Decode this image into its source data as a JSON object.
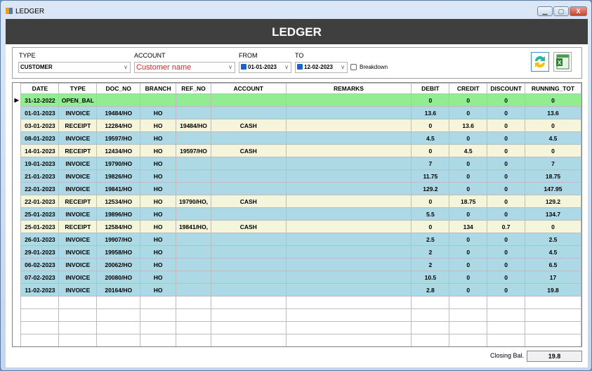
{
  "window": {
    "title": "LEDGER",
    "minimize": "▁",
    "maximize": "▢",
    "close": "X"
  },
  "header": {
    "title": "LEDGER"
  },
  "filters": {
    "type_label": "TYPE",
    "type_value": "CUSTOMER",
    "account_label": "ACCOUNT",
    "account_value": "Customer name",
    "account_color": "#e8202a",
    "from_label": "FROM",
    "from_value": "01-01-2023",
    "from_checked": true,
    "to_label": "TO",
    "to_value": "12-02-2023",
    "to_checked": true,
    "breakdown_label": "Breakdown",
    "breakdown_checked": false,
    "refresh_icon": "refresh-icon",
    "excel_icon": "excel-icon"
  },
  "grid": {
    "columns": [
      "DATE",
      "TYPE",
      "DOC_NO",
      "BRANCH",
      "REF_NO",
      "ACCOUNT",
      "REMARKS",
      "DEBIT",
      "CREDIT",
      "DISCOUNT",
      "RUNNING_TOT"
    ],
    "row_colors": {
      "OPEN_BAL": "#90ee90",
      "INVOICE": "#add8e6",
      "RECEIPT": "#f5f5dc"
    },
    "rows": [
      [
        "31-12-2022",
        "OPEN_BAL",
        "",
        "",
        "",
        "",
        "",
        "0",
        "0",
        "0",
        "0"
      ],
      [
        "01-01-2023",
        "INVOICE",
        "19484/HO",
        "HO",
        "",
        "",
        "",
        "13.6",
        "0",
        "0",
        "13.6"
      ],
      [
        "03-01-2023",
        "RECEIPT",
        "12284/HO",
        "HO",
        "19484/HO",
        "CASH",
        "",
        "0",
        "13.6",
        "0",
        "0"
      ],
      [
        "08-01-2023",
        "INVOICE",
        "19597/HO",
        "HO",
        "",
        "",
        "",
        "4.5",
        "0",
        "0",
        "4.5"
      ],
      [
        "14-01-2023",
        "RECEIPT",
        "12434/HO",
        "HO",
        "19597/HO",
        "CASH",
        "",
        "0",
        "4.5",
        "0",
        "0"
      ],
      [
        "19-01-2023",
        "INVOICE",
        "19790/HO",
        "HO",
        "",
        "",
        "",
        "7",
        "0",
        "0",
        "7"
      ],
      [
        "21-01-2023",
        "INVOICE",
        "19826/HO",
        "HO",
        "",
        "",
        "",
        "11.75",
        "0",
        "0",
        "18.75"
      ],
      [
        "22-01-2023",
        "INVOICE",
        "19841/HO",
        "HO",
        "",
        "",
        "",
        "129.2",
        "0",
        "0",
        "147.95"
      ],
      [
        "22-01-2023",
        "RECEIPT",
        "12534/HO",
        "HO",
        "19790/HO,",
        "CASH",
        "",
        "0",
        "18.75",
        "0",
        "129.2"
      ],
      [
        "25-01-2023",
        "INVOICE",
        "19896/HO",
        "HO",
        "",
        "",
        "",
        "5.5",
        "0",
        "0",
        "134.7"
      ],
      [
        "25-01-2023",
        "RECEIPT",
        "12584/HO",
        "HO",
        "19841/HO,",
        "CASH",
        "",
        "0",
        "134",
        "0.7",
        "0"
      ],
      [
        "26-01-2023",
        "INVOICE",
        "19907/HO",
        "HO",
        "",
        "",
        "",
        "2.5",
        "0",
        "0",
        "2.5"
      ],
      [
        "29-01-2023",
        "INVOICE",
        "19958/HO",
        "HO",
        "",
        "",
        "",
        "2",
        "0",
        "0",
        "4.5"
      ],
      [
        "06-02-2023",
        "INVOICE",
        "20062/HO",
        "HO",
        "",
        "",
        "",
        "2",
        "0",
        "0",
        "6.5"
      ],
      [
        "07-02-2023",
        "INVOICE",
        "20080/HO",
        "HO",
        "",
        "",
        "",
        "10.5",
        "0",
        "0",
        "17"
      ],
      [
        "11-02-2023",
        "INVOICE",
        "20164/HO",
        "HO",
        "",
        "",
        "",
        "2.8",
        "0",
        "0",
        "19.8"
      ]
    ]
  },
  "footer": {
    "closing_label": "Closing Bal.",
    "closing_value": "19.8"
  }
}
